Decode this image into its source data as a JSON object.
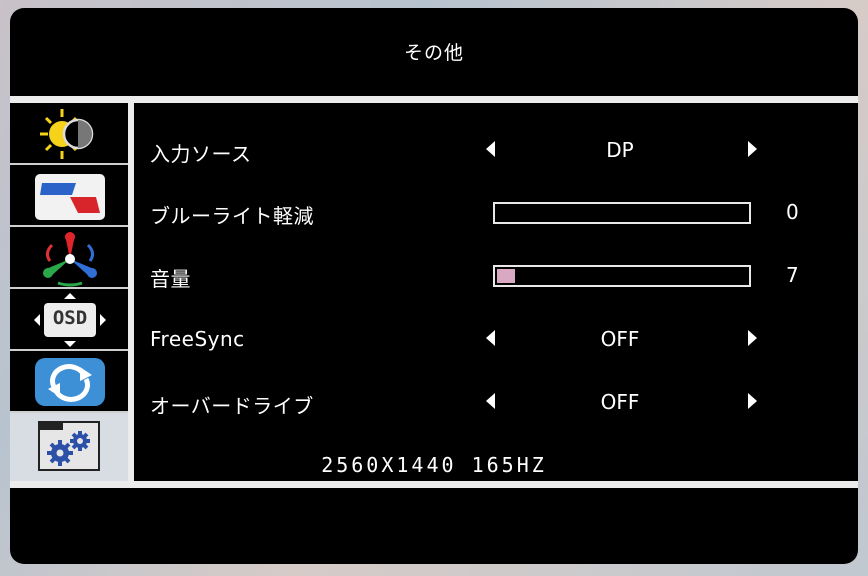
{
  "menu": {
    "title": "その他"
  },
  "sidebar": {
    "items": [
      {
        "icon": "brightness-contrast-icon"
      },
      {
        "icon": "picture-icon"
      },
      {
        "icon": "color-icon"
      },
      {
        "icon": "osd-icon",
        "label": "OSD"
      },
      {
        "icon": "reset-icon"
      },
      {
        "icon": "settings-gears-icon"
      }
    ],
    "active_index": 5
  },
  "rows": {
    "input_source": {
      "label": "入力ソース",
      "value": "DP"
    },
    "blue_light": {
      "label": "ブルーライト軽減",
      "value": "0",
      "level": 0
    },
    "volume": {
      "label": "音量",
      "value": "7",
      "level": 7
    },
    "freesync": {
      "label": "FreeSync",
      "value": "OFF"
    },
    "overdrive": {
      "label": "オーバードライブ",
      "value": "OFF"
    }
  },
  "status": {
    "resolution": "2560X1440 165HZ"
  },
  "colors": {
    "background": "#000000",
    "text": "#ffffff",
    "divider": "#ececec",
    "volume_fill": "#d9a9c4"
  }
}
